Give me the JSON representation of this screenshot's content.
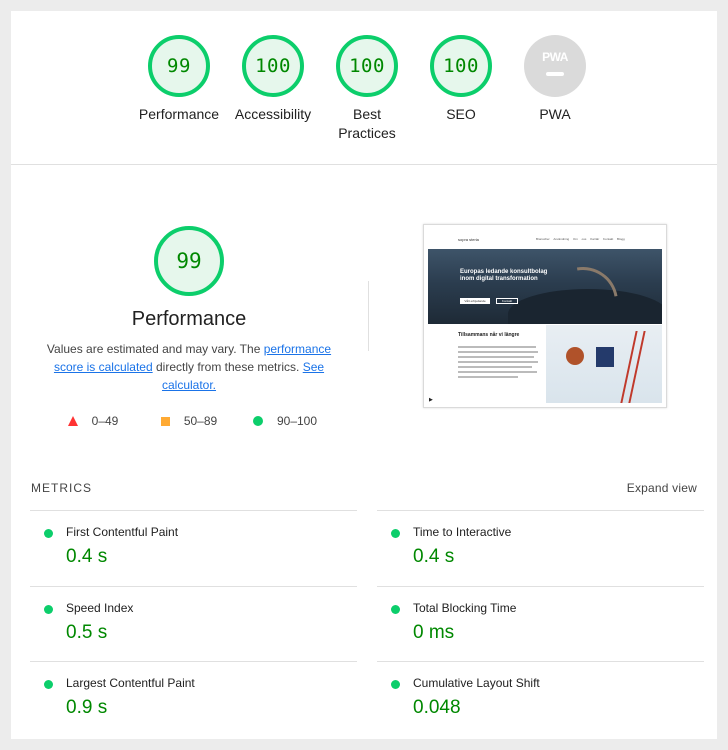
{
  "categories": [
    {
      "score": "99",
      "label": "Performance"
    },
    {
      "score": "100",
      "label": "Accessibility"
    },
    {
      "score": "100",
      "label": "Best Practices"
    },
    {
      "score": "100",
      "label": "SEO"
    },
    {
      "score": "",
      "label": "PWA",
      "badge": "PWA"
    }
  ],
  "performance": {
    "score": "99",
    "title": "Performance",
    "desc_prefix": "Values are estimated and may vary. The ",
    "desc_link1": "performance score is calculated",
    "desc_middle": " directly from these metrics. ",
    "desc_link2": "See calculator."
  },
  "legend": [
    {
      "range": "0–49",
      "shape": "triangle",
      "color": "#ff3333"
    },
    {
      "range": "50–89",
      "shape": "square",
      "color": "#ffaa33"
    },
    {
      "range": "90–100",
      "shape": "circle",
      "color": "#0cce6b"
    }
  ],
  "thumbnail": {
    "logo": "sopra steria",
    "nav": "Branscher Användning Om oss Karriär Kontakt Blogg",
    "headline": "Europas ledande konsultbolag inom digital transformation",
    "button1": "Vårt erbjudande",
    "button2": "Kontakt",
    "subheadline": "Tillsammans når vi längre"
  },
  "metrics": {
    "title": "METRICS",
    "expand_label": "Expand view",
    "items": [
      {
        "name": "First Contentful Paint",
        "value": "0.4 s"
      },
      {
        "name": "Time to Interactive",
        "value": "0.4 s"
      },
      {
        "name": "Speed Index",
        "value": "0.5 s"
      },
      {
        "name": "Total Blocking Time",
        "value": "0 ms"
      },
      {
        "name": "Largest Contentful Paint",
        "value": "0.9 s"
      },
      {
        "name": "Cumulative Layout Shift",
        "value": "0.048"
      }
    ]
  },
  "colors": {
    "pass": "#0cce6b",
    "pass_text": "#008800",
    "link": "#1a73e8"
  }
}
